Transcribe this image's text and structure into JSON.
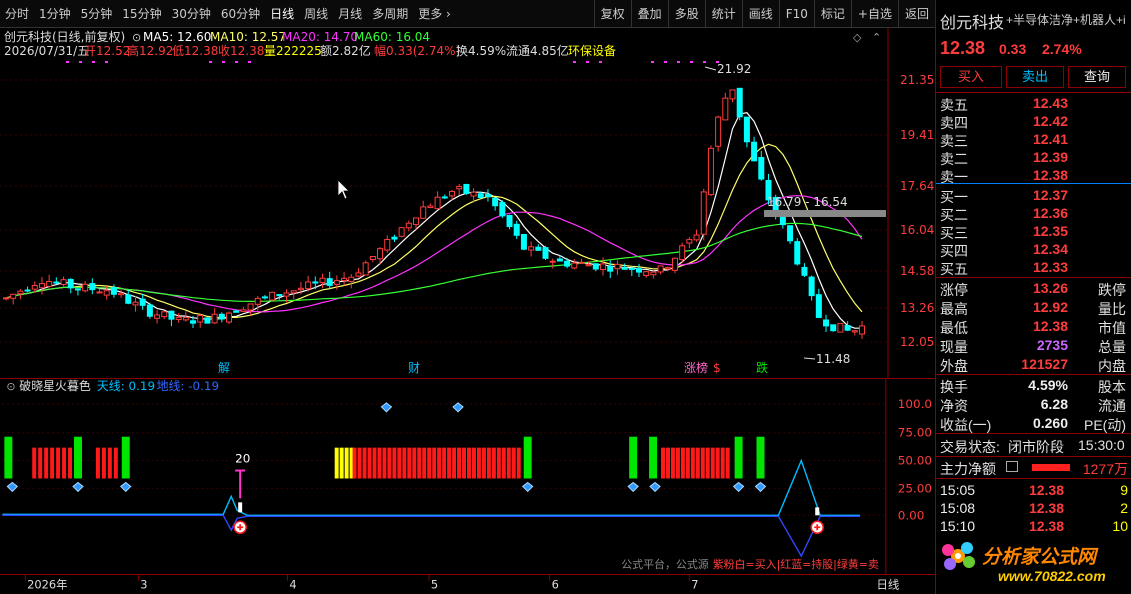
{
  "toolbar": {
    "periods": [
      "分时",
      "1分钟",
      "5分钟",
      "15分钟",
      "30分钟",
      "60分钟",
      "日线",
      "周线",
      "月线",
      "多周期",
      "更多"
    ],
    "active_period": "日线",
    "right_items": [
      "复权",
      "叠加",
      "多股",
      "统计",
      "画线",
      "F10",
      "标记",
      "+自选",
      "返回"
    ]
  },
  "chart_header": {
    "title": "创元科技(日线,前复权)",
    "ma5": "MA5: 12.60",
    "ma10": "MA10: 12.57",
    "ma20": "MA20: 14.70",
    "ma60": "MA60: 16.04",
    "date": "2026/07/31/五",
    "open": "开12.52",
    "high": "高12.92",
    "low": "低12.38",
    "close": "收12.38",
    "volume": "量222225",
    "amount": "额2.82亿",
    "change": "幅0.33(2.74%)",
    "turnover": "换4.59%",
    "float_cap": "流通4.85亿",
    "concept": "环保设备"
  },
  "price_axis": [
    "21.35",
    "19.41",
    "17.64",
    "16.04",
    "14.58",
    "13.26",
    "12.05"
  ],
  "annotations": {
    "high_mark": "21.92",
    "low_mark": "11.48",
    "range_box": "16.79 - 16.54",
    "events": [
      "解",
      "财",
      "涨榜",
      "$",
      "跌"
    ]
  },
  "indicator": {
    "name": "破晓星火暮色",
    "line1": "天线: 0.19",
    "line2": "地线: -0.19",
    "axis": [
      "100.0",
      "75.00",
      "50.00",
      "25.00",
      "0.00"
    ],
    "peak_label": "20",
    "footer_note": "公式平台，公式源",
    "legend": "紫粉白=买入|红蓝=持股|绿黄=卖"
  },
  "time_axis": {
    "labels": [
      "2026年",
      "3",
      "4",
      "5",
      "6",
      "7"
    ],
    "period": "日线"
  },
  "quote": {
    "name": "创元科技",
    "tags": "+半导体洁净+机器人+i",
    "price": "12.38",
    "change": "0.33",
    "change_pct": "2.74%",
    "buy_btn": "买入",
    "sell_btn": "卖出",
    "query_btn": "查询",
    "asks": [
      {
        "label": "卖五",
        "price": "12.43"
      },
      {
        "label": "卖四",
        "price": "12.42"
      },
      {
        "label": "卖三",
        "price": "12.41"
      },
      {
        "label": "卖二",
        "price": "12.39"
      },
      {
        "label": "卖一",
        "price": "12.38"
      }
    ],
    "bids": [
      {
        "label": "买一",
        "price": "12.37"
      },
      {
        "label": "买二",
        "price": "12.36"
      },
      {
        "label": "买三",
        "price": "12.35"
      },
      {
        "label": "买四",
        "price": "12.34"
      },
      {
        "label": "买五",
        "price": "12.33"
      }
    ],
    "stats": [
      {
        "l1": "涨停",
        "v1": "13.26",
        "l2": "跌停"
      },
      {
        "l1": "最高",
        "v1": "12.92",
        "l2": "量比"
      },
      {
        "l1": "最低",
        "v1": "12.38",
        "l2": "市值"
      },
      {
        "l1": "现量",
        "v1": "2735",
        "l2": "总量"
      },
      {
        "l1": "外盘",
        "v1": "121527",
        "l2": "内盘"
      }
    ],
    "stats2": [
      {
        "l1": "换手",
        "v1": "4.59%",
        "l2": "股本"
      },
      {
        "l1": "净资",
        "v1": "6.28",
        "l2": "流通"
      },
      {
        "l1": "收益(一)",
        "v1": "0.260",
        "l2": "PE(动)"
      }
    ],
    "status_label": "交易状态:",
    "status_value": "闭市阶段",
    "status_time": "15:30:0",
    "net_label": "主力净额",
    "net_value": "1277万",
    "ticks": [
      {
        "time": "15:05",
        "price": "12.38",
        "vol": "9"
      },
      {
        "time": "15:08",
        "price": "12.38",
        "vol": "2"
      },
      {
        "time": "15:10",
        "price": "12.38",
        "vol": "10"
      }
    ],
    "logo_text": "分析家公式网",
    "logo_url": "www.70822.com"
  },
  "colors": {
    "up": "#ff3c3c",
    "down": "#00ffff",
    "ma5": "#ffffff",
    "ma10": "#ffff66",
    "ma20": "#ff33ff",
    "ma60": "#33ff33"
  }
}
